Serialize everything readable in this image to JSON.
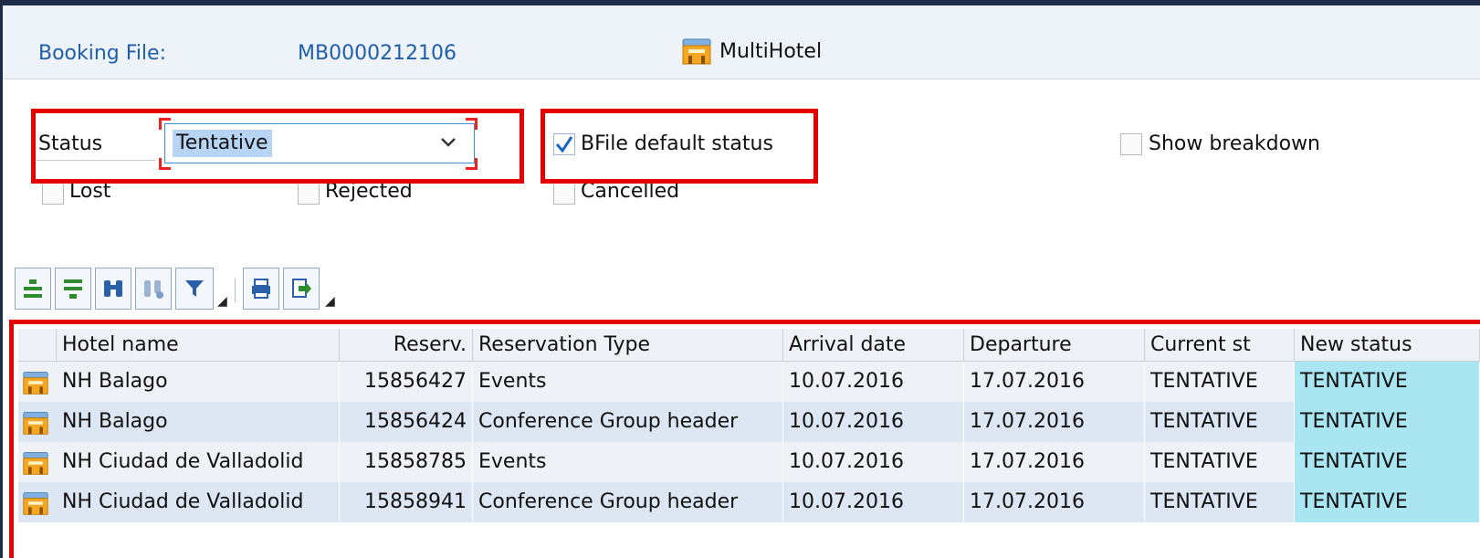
{
  "header": {
    "booking_file_label": "Booking File:",
    "booking_file_value": "MB0000212106",
    "app_icon": "hotel-building-icon",
    "app_label": "MultiHotel"
  },
  "filters": {
    "status_label": "Status",
    "status_value": "Tentative",
    "bfile_default_label": "BFile default status",
    "bfile_default_checked": true,
    "show_breakdown_label": "Show breakdown",
    "lost_label": "Lost",
    "rejected_label": "Rejected",
    "cancelled_label": "Cancelled"
  },
  "toolbar": {
    "buttons": [
      "align-top-icon",
      "align-bottom-icon",
      "binoculars-icon",
      "find-next-icon",
      "filter-icon",
      "print-icon",
      "export-icon"
    ]
  },
  "table": {
    "columns": [
      "Hotel name",
      "Reserv.",
      "Reservation Type",
      "Arrival date",
      "Departure",
      "Current st",
      "New status"
    ],
    "rows": [
      [
        "NH Balago",
        "15856427",
        "Events",
        "10.07.2016",
        "17.07.2016",
        "TENTATIVE",
        "TENTATIVE"
      ],
      [
        "NH Balago",
        "15856424",
        "Conference Group header",
        "10.07.2016",
        "17.07.2016",
        "TENTATIVE",
        "TENTATIVE"
      ],
      [
        "NH Ciudad de Valladolid",
        "15858785",
        "Events",
        "10.07.2016",
        "17.07.2016",
        "TENTATIVE",
        "TENTATIVE"
      ],
      [
        "NH Ciudad de Valladolid",
        "15858941",
        "Conference Group header",
        "10.07.2016",
        "17.07.2016",
        "TENTATIVE",
        "TENTATIVE"
      ]
    ]
  },
  "colors": {
    "highlight": "#e40000",
    "link_blue": "#1f5ea8",
    "new_status_bg": "#a9e6f2",
    "row_alt": "#dce7f3"
  }
}
